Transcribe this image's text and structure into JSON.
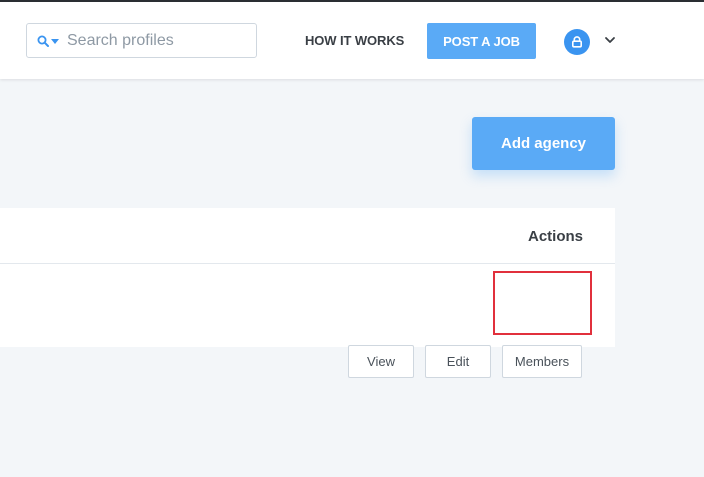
{
  "header": {
    "search": {
      "placeholder": "Search profiles",
      "value": ""
    },
    "how_it_works_label": "HOW IT WORKS",
    "post_job_label": "POST A JOB"
  },
  "main": {
    "add_agency_label": "Add agency",
    "table": {
      "columns": [
        "Actions"
      ],
      "rows": [
        {
          "actions": [
            "View",
            "Edit",
            "Members"
          ]
        }
      ]
    }
  },
  "colors": {
    "accent": "#5aaaf6",
    "highlight": "#e1303c"
  }
}
